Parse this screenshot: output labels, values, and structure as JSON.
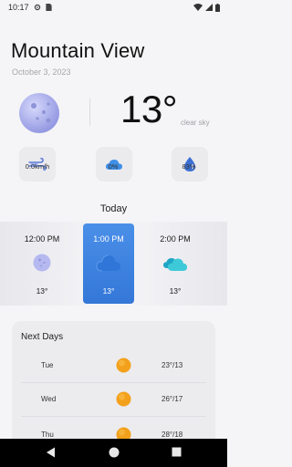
{
  "status_bar": {
    "time": "10:17",
    "icons": [
      "settings-icon",
      "sim-card-icon",
      "wifi-icon",
      "signal-icon",
      "battery-icon"
    ]
  },
  "location": {
    "city": "Mountain View",
    "date": "October 3, 2023"
  },
  "current": {
    "icon": "moon-icon",
    "temperature": "13°",
    "condition": "clear sky"
  },
  "metrics": [
    {
      "icon": "wind-icon",
      "value": "0.0km/h"
    },
    {
      "icon": "cloud-icon",
      "value": "0%"
    },
    {
      "icon": "humidity-icon",
      "value": "83%"
    }
  ],
  "today": {
    "label": "Today",
    "hours": [
      {
        "time": "12:00 PM",
        "icon": "moon-icon",
        "temp": "13°",
        "active": false
      },
      {
        "time": "1:00 PM",
        "icon": "cloud-icon",
        "temp": "13°",
        "active": true
      },
      {
        "time": "2:00 PM",
        "icon": "cloud-sun-icon",
        "temp": "13°",
        "active": false
      }
    ]
  },
  "next_days": {
    "title": "Next Days",
    "days": [
      {
        "day": "Tue",
        "icon": "sun-icon",
        "temps": "23°/13"
      },
      {
        "day": "Wed",
        "icon": "sun-icon",
        "temps": "26°/17"
      },
      {
        "day": "Thu",
        "icon": "sun-icon",
        "temps": "28°/18"
      }
    ]
  },
  "colors": {
    "accent": "#3b82e0",
    "sun": "#f0a020",
    "moon": "#b9bdf0"
  },
  "nav": [
    "back-icon",
    "home-icon",
    "recents-icon"
  ]
}
